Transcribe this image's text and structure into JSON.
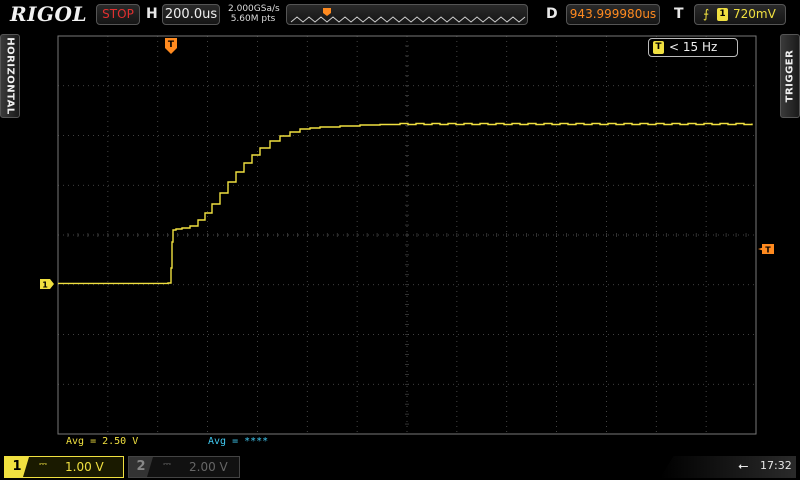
{
  "brand": "RIGOL",
  "top": {
    "run_status": "STOP",
    "horizontal_label": "H",
    "timebase": "200.0us",
    "sample_rate": "2.000GSa/s",
    "memory_depth": "5.60M pts",
    "delay_label": "D",
    "delay": "943.999980us",
    "trigger_label": "T",
    "trigger_source": "1",
    "trigger_level": "720mV"
  },
  "side_tabs": {
    "left": "HORIZONTAL",
    "right": "TRIGGER"
  },
  "frequency": {
    "icon_text": "T",
    "value": "< 15 Hz"
  },
  "markers": {
    "channel1": "1",
    "trigger_position": "T",
    "trigger_level_marker": "T"
  },
  "measurements": {
    "ch1": "Avg = 2.50 V",
    "ch2": "Avg = ****"
  },
  "channels": [
    {
      "number": "1",
      "coupling": "⎓",
      "scale": "1.00 V",
      "color": "#f0e040",
      "active": true
    },
    {
      "number": "2",
      "coupling": "⎓",
      "scale": "2.00 V",
      "color": "#666666",
      "active": false
    }
  ],
  "status": {
    "usb_icon": "usb-icon",
    "time": "17:32"
  },
  "colors": {
    "channel1": "#f0e040",
    "channel2": "#40c8f0",
    "trigger": "#ff8a1f",
    "stop": "#e03030",
    "grid": "#555555"
  }
}
